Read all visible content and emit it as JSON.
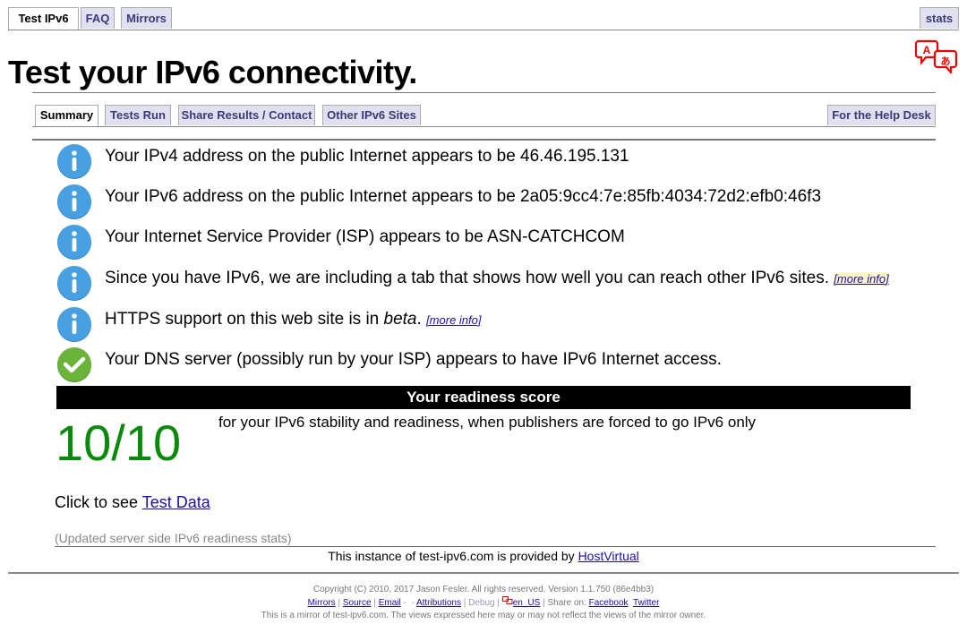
{
  "topnav": {
    "tabs": [
      {
        "label": "Test IPv6",
        "active": true
      },
      {
        "label": "FAQ",
        "active": false
      },
      {
        "label": "Mirrors",
        "active": false
      }
    ],
    "stats_label": "stats"
  },
  "header": {
    "title": "Test your IPv6 connectivity.",
    "language_icon": "translate-icon"
  },
  "subnav": {
    "tabs": [
      {
        "label": "Summary",
        "active": true
      },
      {
        "label": "Tests Run",
        "active": false
      },
      {
        "label": "Share Results / Contact",
        "active": false
      },
      {
        "label": "Other IPv6 Sites",
        "active": false
      }
    ],
    "helpdesk_label": "For the Help Desk"
  },
  "messages": [
    {
      "icon": "info-icon",
      "text": "Your IPv4 address on the public Internet appears to be 46.46.195.131"
    },
    {
      "icon": "info-icon",
      "text": "Your IPv6 address on the public Internet appears to be 2a05:9cc4:7e:85fb:4034:72d2:efb0:46f3"
    },
    {
      "icon": "info-icon",
      "text": "Your Internet Service Provider (ISP) appears to be ASN-CATCHCOM"
    },
    {
      "icon": "info-icon",
      "text": "Since you have IPv6, we are including a tab that shows how well you can reach other IPv6 sites. ",
      "link": "[more info]"
    },
    {
      "icon": "info-icon",
      "text_pre": "HTTPS support on this web site is in ",
      "text_em": "beta",
      "text_post": ". ",
      "link": "[more info]"
    },
    {
      "icon": "check-icon",
      "text": "Your DNS server (possibly run by your ISP) appears to have IPv6 Internet access."
    }
  ],
  "readiness": {
    "header": "Your readiness score",
    "score": "10/10",
    "description": "for your IPv6 stability and readiness, when publishers are forced to go IPv6 only",
    "score_color": "#0a8a0a"
  },
  "test_data": {
    "prefix": "Click to see ",
    "link": "Test Data"
  },
  "updated_stats": "(Updated server side IPv6 readiness stats)",
  "provided_by": {
    "text": "This instance of test-ipv6.com is provided by ",
    "link": "HostVirtual"
  },
  "footer": {
    "copyright": "Copyright (C) 2010, 2017 Jason Fesler. All rights reserved. Version 1.1.750 (86e4bb3)",
    "links": {
      "mirrors": "Mirrors",
      "source": "Source",
      "email": "Email",
      "attributions": "Attributions",
      "debug": "Debug",
      "locale": "en_US",
      "share_label": "Share on:",
      "facebook": "Facebook",
      "twitter": "Twitter"
    },
    "disclaimer": "This is a mirror of test-ipv6.com. The views expressed here may or may not reflect the views of the mirror owner."
  }
}
